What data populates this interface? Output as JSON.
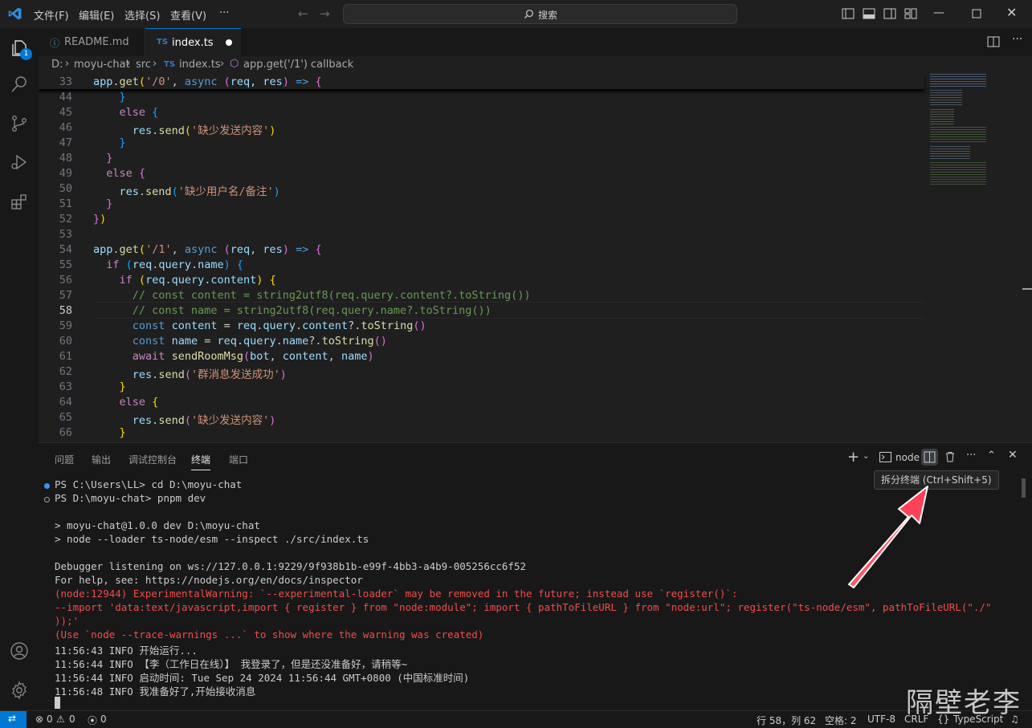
{
  "titlebar": {
    "menus": [
      "文件(F)",
      "编辑(E)",
      "选择(S)",
      "查看(V)",
      "···"
    ],
    "search_label": "搜索"
  },
  "activity": {
    "explorer_badge": "1"
  },
  "tabs": [
    {
      "label": "README.md",
      "icon": "ⓘ"
    },
    {
      "label": "index.ts",
      "icon": "TS"
    }
  ],
  "breadcrumb": [
    "D:",
    "moyu-chat",
    "src",
    "index.ts",
    "app.get('/1') callback"
  ],
  "editor": {
    "sticky_line": "33",
    "line_numbers": [
      "44",
      "45",
      "46",
      "47",
      "48",
      "49",
      "50",
      "51",
      "52",
      "53",
      "54",
      "55",
      "56",
      "57",
      "58",
      "59",
      "60",
      "61",
      "62",
      "63",
      "64",
      "65",
      "66"
    ],
    "active_line": "58"
  },
  "panel": {
    "tabs": [
      "问题",
      "输出",
      "调试控制台",
      "终端",
      "端口"
    ],
    "active_tab": "终端",
    "terminal_name": "node",
    "tooltip": "拆分终端 (Ctrl+Shift+5)",
    "lines": [
      "PS C:\\Users\\LL> cd D:\\moyu-chat",
      "PS D:\\moyu-chat> pnpm dev",
      "",
      "> moyu-chat@1.0.0 dev D:\\moyu-chat",
      "> node --loader ts-node/esm --inspect ./src/index.ts",
      "",
      "Debugger listening on ws://127.0.0.1:9229/9f938b1b-e99f-4bb3-a4b9-005256cc6f52",
      "For help, see: https://nodejs.org/en/docs/inspector",
      "(node:12944) ExperimentalWarning: `--experimental-loader` may be removed in the future; instead use `register()`:",
      "--import 'data:text/javascript,import { register } from \"node:module\"; import { pathToFileURL } from \"node:url\"; register(\"ts-node/esm\", pathToFileURL(\"./\"",
      "));'",
      "(Use `node --trace-warnings ...` to show where the warning was created)",
      "11:56:43 INFO 开始运行...",
      "11:56:44 INFO 【李（工作日在线）】 我登录了，但是还没准备好，请稍等~",
      "11:56:44 INFO 启动时间: Tue Sep 24 2024 11:56:44 GMT+0800 (中国标准时间)",
      "11:56:48 INFO 我准备好了,开始接收消息"
    ]
  },
  "statusbar": {
    "errors": "0",
    "warnings": "0",
    "ports": "0",
    "position": "行 58，列 62",
    "indent": "空格: 2",
    "encoding": "UTF-8",
    "eol": "CRLF",
    "language": "TypeScript"
  },
  "watermark": "隔壁老李"
}
